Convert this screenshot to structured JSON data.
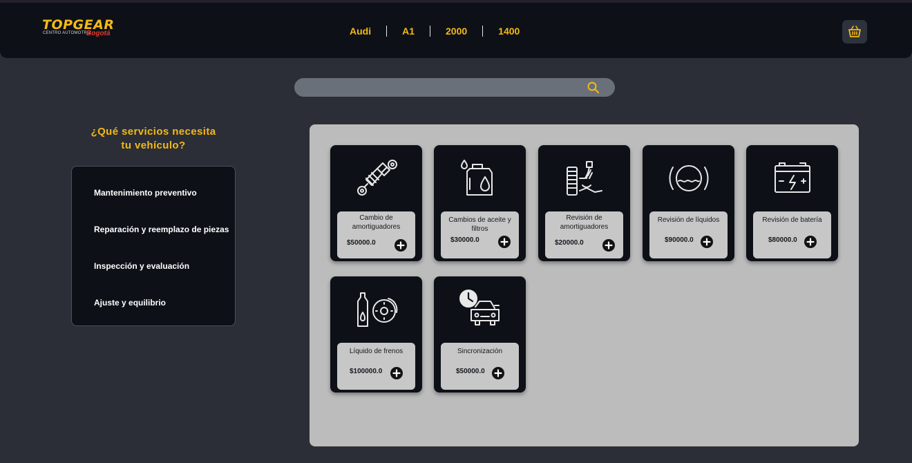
{
  "header": {
    "logo": {
      "brand": "TOPGEAR",
      "subtitle": "CENTRO AUTOMOTRIZ",
      "city": "Bogotá"
    },
    "vehicle": [
      "Audi",
      "A1",
      "2000",
      "1400"
    ],
    "cart_icon": "shopping-basket-icon"
  },
  "search": {
    "value": "",
    "placeholder": "",
    "icon": "search-icon"
  },
  "question": {
    "line1": "¿Qué servicios necesita",
    "line2": "tu vehículo?"
  },
  "categories": [
    "Mantenimiento preventivo",
    "Reparación y reemplazo de piezas",
    "Inspección y evaluación",
    "Ajuste y equilibrio"
  ],
  "services": [
    {
      "name": "Cambio de amortiguadores",
      "price": "$50000.0",
      "icon": "shock-absorber-icon"
    },
    {
      "name": "Cambios de aceite y filtros",
      "price": "$30000.0",
      "icon": "oil-can-icon"
    },
    {
      "name": "Revisión de amortiguadores",
      "price": "$20000.0",
      "icon": "suspension-icon"
    },
    {
      "name": "Revisión de líquidos",
      "price": "$90000.0",
      "icon": "fluid-level-icon"
    },
    {
      "name": "Revisión de batería",
      "price": "$80000.0",
      "icon": "battery-icon"
    },
    {
      "name": "Líquido de frenos",
      "price": "$100000.0",
      "icon": "brake-fluid-icon"
    },
    {
      "name": "Sincronización",
      "price": "$50000.0",
      "icon": "car-timing-icon"
    }
  ],
  "colors": {
    "accent": "#f5b917",
    "header_bg": "#0d1117",
    "page_bg": "#2b2e36",
    "panel_bg": "#bcbcbc"
  }
}
